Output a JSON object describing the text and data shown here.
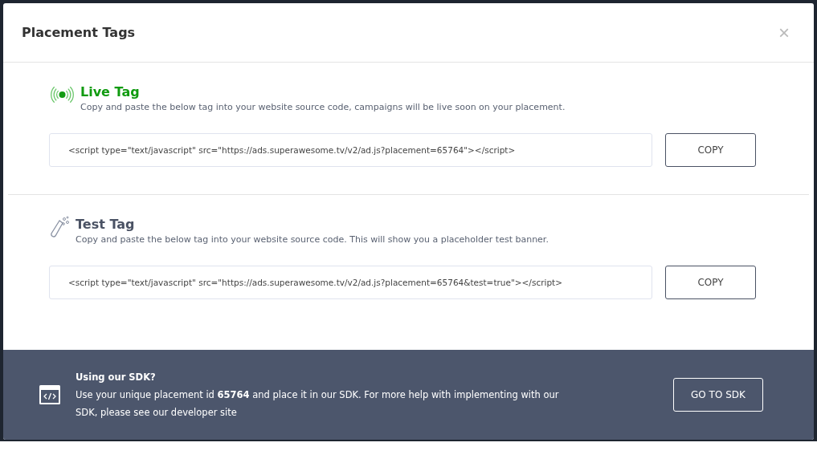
{
  "dialog": {
    "title": "Placement Tags",
    "close": "×"
  },
  "tags": [
    {
      "kind": "live",
      "title": "Live Tag",
      "description": "Copy and paste the below tag into your website source code, campaigns will be live soon on your placement.",
      "code": "<script type=\"text/javascript\" src=\"https://ads.superawesome.tv/v2/ad.js?placement=65764\"></script>",
      "button": "COPY"
    },
    {
      "kind": "test",
      "title": "Test Tag",
      "description": "Copy and paste the below tag into your website source code. This will show you a placeholder test banner.",
      "code": "<script type=\"text/javascript\" src=\"https://ads.superawesome.tv/v2/ad.js?placement=65764&test=true\"></script>",
      "button": "COPY"
    }
  ],
  "sdk": {
    "title": "Using our SDK?",
    "text": "Use your unique placement id **65764** and place it in our SDK. For more help with implementing with our SDK, please see our developer site",
    "button": "GO TO SDK"
  }
}
